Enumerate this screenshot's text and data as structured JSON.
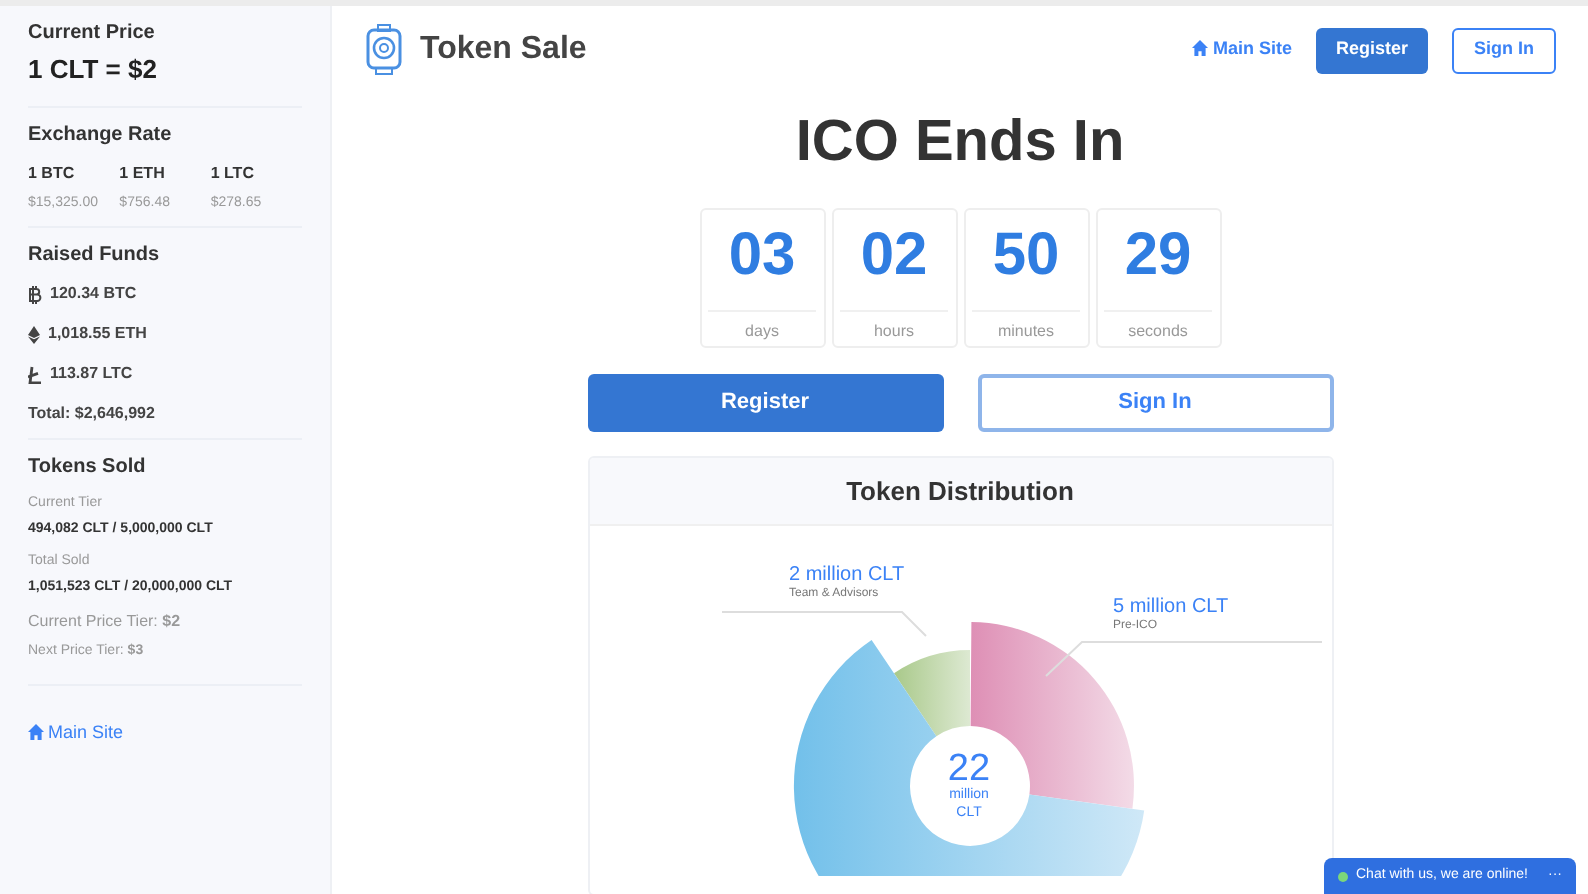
{
  "sidebar": {
    "current_price": {
      "title": "Current Price",
      "value": "1 CLT = $2"
    },
    "exchange_rate": {
      "title": "Exchange Rate",
      "rates": [
        {
          "coin": "1 BTC",
          "price": "$15,325.00"
        },
        {
          "coin": "1 ETH",
          "price": "$756.48"
        },
        {
          "coin": "1 LTC",
          "price": "$278.65"
        }
      ]
    },
    "raised_funds": {
      "title": "Raised Funds",
      "items": [
        {
          "kind": "btc",
          "text": "120.34 BTC"
        },
        {
          "kind": "eth",
          "text": "1,018.55 ETH"
        },
        {
          "kind": "ltc",
          "text": "113.87 LTC"
        }
      ],
      "total": "Total: $2,646,992"
    },
    "tokens_sold": {
      "title": "Tokens Sold",
      "current_tier_label": "Current Tier",
      "current_tier": "494,082 CLT / 5,000,000 CLT",
      "total_sold_label": "Total Sold",
      "total_sold": "1,051,523 CLT / 20,000,000 CLT",
      "current_price_tier": "Current Price Tier: **$2**",
      "next_price_tier": "Next Price Tier: **$3**"
    },
    "link": "Main Site"
  },
  "header": {
    "title": "Token Sale",
    "link": "Main Site",
    "register": "Register",
    "sign_in": "Sign In"
  },
  "countdown": {
    "title": "ICO Ends In",
    "units": [
      {
        "value": "03",
        "label": "days"
      },
      {
        "value": "02",
        "label": "hours"
      },
      {
        "value": "50",
        "label": "minutes"
      },
      {
        "value": "29",
        "label": "seconds"
      }
    ]
  },
  "buttons": {
    "register": "Register",
    "sign_in": "Sign In"
  },
  "distribution": {
    "title": "Token Distribution",
    "labels": [
      {
        "amount": "2 million CLT",
        "caption": "Team & Advisors"
      },
      {
        "amount": "5 million CLT",
        "caption": "Pre-ICO"
      }
    ],
    "center_value": "22",
    "center_unit": "million",
    "center_token": "CLT"
  },
  "chat": {
    "text": "Chat with us, we are online!",
    "more": "···"
  }
}
